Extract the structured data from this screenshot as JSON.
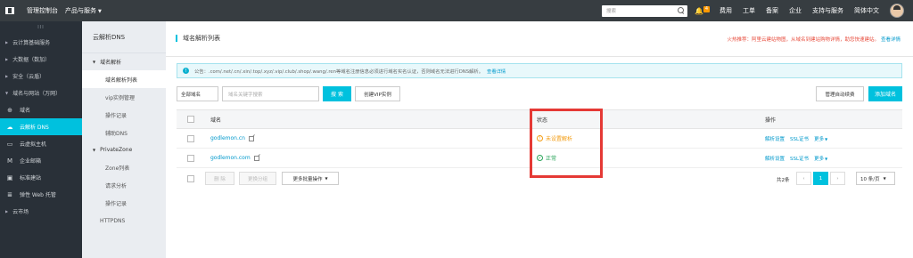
{
  "topbar": {
    "console": "管理控制台",
    "products": "产品与服务",
    "search_placeholder": "搜索",
    "notif_count": "4",
    "items": [
      "费用",
      "工单",
      "备案",
      "企业",
      "支持与服务",
      "简体中文"
    ]
  },
  "sidebar": {
    "handle": "III",
    "items": [
      {
        "label": "云计算基础服务"
      },
      {
        "label": "大数据（数加）"
      },
      {
        "label": "安全（云盾）"
      },
      {
        "label": "域名与网站（万网）"
      },
      {
        "label": "域名"
      },
      {
        "label": "云解析 DNS"
      },
      {
        "label": "云虚拟主机"
      },
      {
        "label": "企业邮箱"
      },
      {
        "label": "标准建站"
      },
      {
        "label": "弹性 Web 托管"
      },
      {
        "label": "云市场"
      }
    ]
  },
  "subnav": {
    "title": "云解析DNS",
    "group1": "域名解析",
    "item_list": "域名解析列表",
    "item_vip": "vip实例管理",
    "item_log": "操作记录",
    "item_aux": "辅助DNS",
    "group2": "PrivateZone",
    "item_zone": "Zone列表",
    "item_req": "请求分析",
    "item_log2": "操作记录",
    "item_httpdns": "HTTPDNS"
  },
  "header": {
    "title": "域名解析列表",
    "promo": "火热推荐：阿里云建站物图，从域名到建站购物详情，助您快速建站。",
    "promo_link": "查看详情"
  },
  "notice": {
    "text": "公告：.com/.net/.cn/.xin/.top/.xyz/.vip/.club/.shop/.wang/.ren等域名注册信息必须进行域名实名认证，否则域名无法进行DNS解析。",
    "link": "查看详情"
  },
  "toolbar": {
    "scope": "全部域名",
    "search_placeholder": "域名关键字搜索",
    "search_btn": "搜 索",
    "create_vip": "创建VIP实例",
    "manage_btn": "管理自动续费",
    "add_btn": "添加域名"
  },
  "table": {
    "headers": {
      "name": "域名",
      "status": "状态",
      "ops": "操作"
    },
    "rows": [
      {
        "domain": "godlemon.cn",
        "status": "未设置解析",
        "ops": [
          "解析设置",
          "SSL证书",
          "更多"
        ]
      },
      {
        "domain": "godlemon.com",
        "status": "正常",
        "ops": [
          "解析设置",
          "SSL证书",
          "更多"
        ]
      }
    ],
    "footer": {
      "delete": "删 除",
      "change_group": "更换分组",
      "more_bulk": "更多批量操作",
      "total": "共2条",
      "prev": "‹",
      "page": "1",
      "next": "›",
      "page_size": "10 条/页"
    }
  },
  "colors": {
    "accent": "#00c1de",
    "topbar": "#373d41",
    "sidebar": "#293038",
    "highlight": "#e53935"
  }
}
